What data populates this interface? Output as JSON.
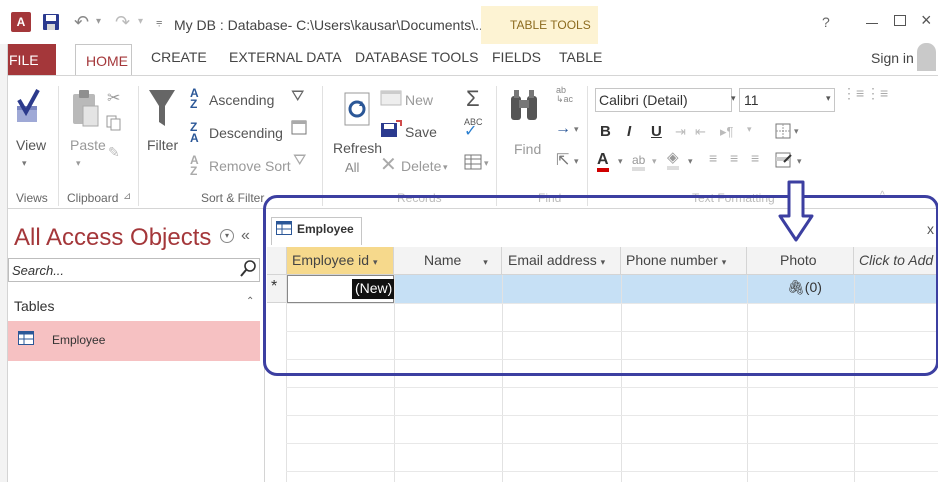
{
  "window": {
    "title": "My DB : Database- C:\\Users\\kausar\\Documents\\...",
    "contextual_tab": "TABLE TOOLS",
    "help": "?",
    "sign_in": "Sign in"
  },
  "ribbon_tabs": [
    "FILE",
    "HOME",
    "CREATE",
    "EXTERNAL DATA",
    "DATABASE TOOLS",
    "FIELDS",
    "TABLE"
  ],
  "ribbon": {
    "views": {
      "view_label": "View",
      "group": "Views"
    },
    "clipboard": {
      "paste_label": "Paste",
      "group": "Clipboard"
    },
    "sort_filter": {
      "filter_label": "Filter",
      "ascending": "Ascending",
      "descending": "Descending",
      "remove_sort": "Remove Sort",
      "group": "Sort & Filter"
    },
    "records": {
      "refresh_label": "Refresh",
      "refresh_sub": "All",
      "new_label": "New",
      "save_label": "Save",
      "delete_label": "Delete",
      "group": "Records"
    },
    "find": {
      "find_label": "Find",
      "group": "Find"
    },
    "text_formatting": {
      "font": "Calibri (Detail)",
      "size": "11",
      "bold": "B",
      "italic": "I",
      "underline": "U",
      "group": "Text Formatting"
    }
  },
  "nav_pane": {
    "title": "All Access Objects",
    "collapse": "«",
    "search_placeholder": "Search...",
    "section": "Tables",
    "items": [
      "Employee"
    ]
  },
  "document": {
    "tab_label": "Employee",
    "close": "x",
    "columns": [
      "Employee id",
      "Name",
      "Email address",
      "Phone number",
      "Photo",
      "Click to Add"
    ],
    "new_row": {
      "marker": "*",
      "id": "(New)",
      "attachment": "(0)"
    }
  }
}
